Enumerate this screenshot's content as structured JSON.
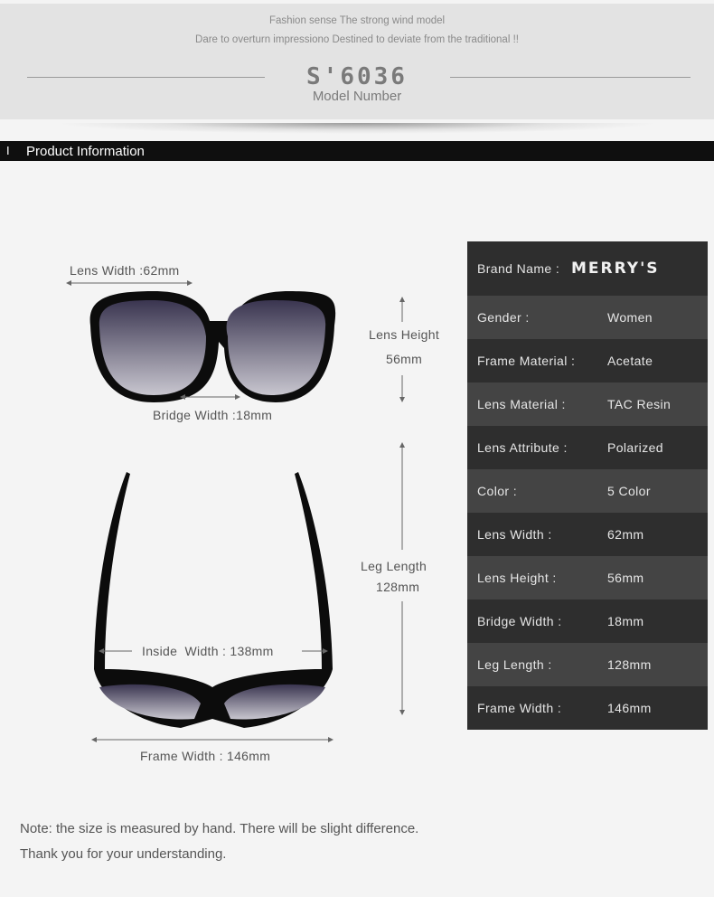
{
  "header": {
    "tagline1": "Fashion sense The strong wind model",
    "tagline2": "Dare to overturn impressiono Destined to deviate from the traditional !!",
    "model": "S'6036",
    "model_caption": "Model Number"
  },
  "section": {
    "pipe": "I",
    "title": "Product Information"
  },
  "diagram": {
    "lens_width": "Lens Width :62mm",
    "lens_height_label": "Lens Height",
    "lens_height_value": "56mm",
    "bridge_width": "Bridge Width :18mm",
    "leg_length_label": "Leg Length",
    "leg_length_value": "128mm",
    "inside_width": "Inside  Width : 138mm",
    "frame_width": "Frame Width : 146mm"
  },
  "specs": {
    "brand_label": "Brand Name :",
    "brand_value": "MERRY'S",
    "rows": [
      {
        "k": "Gender :",
        "v": "Women"
      },
      {
        "k": "Frame Material :",
        "v": "Acetate"
      },
      {
        "k": "Lens Material :",
        "v": "TAC Resin"
      },
      {
        "k": "Lens Attribute :",
        "v": "Polarized"
      },
      {
        "k": "Color :",
        "v": "5 Color"
      },
      {
        "k": "Lens Width :",
        "v": "62mm"
      },
      {
        "k": "Lens Height :",
        "v": "56mm"
      },
      {
        "k": "Bridge Width :",
        "v": "18mm"
      },
      {
        "k": "Leg Length :",
        "v": "128mm"
      },
      {
        "k": "Frame Width :",
        "v": "146mm"
      }
    ]
  },
  "note": {
    "line1": "Note: the size is measured by hand. There will be slight difference.",
    "line2": "Thank you for your understanding."
  }
}
